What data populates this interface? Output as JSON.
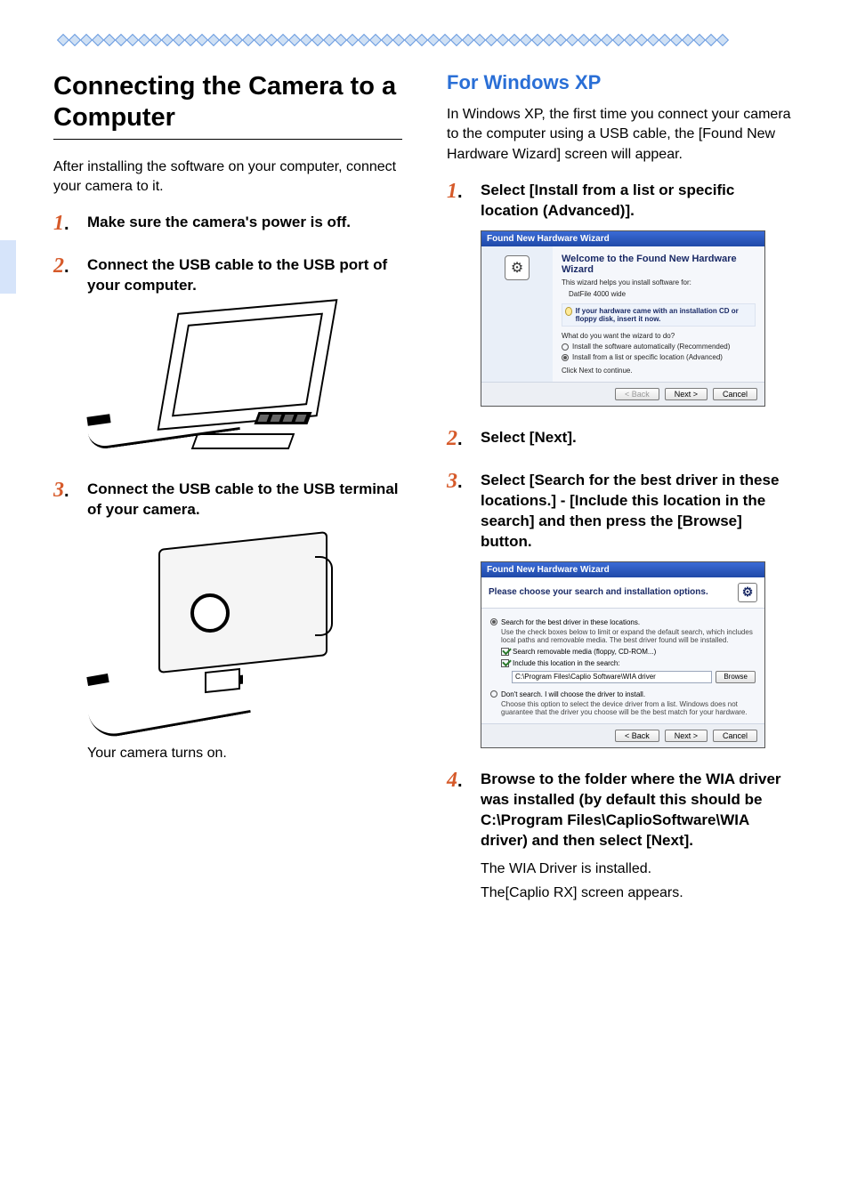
{
  "left": {
    "heading": "Connecting the Camera to a Computer",
    "intro": "After installing the software on your computer, connect your camera to it.",
    "steps": [
      {
        "num": "1",
        "text": "Make sure the camera's power is off."
      },
      {
        "num": "2",
        "text": "Connect the USB cable to the USB port of your computer."
      },
      {
        "num": "3",
        "text": "Connect the USB cable to the USB terminal of your camera."
      }
    ],
    "note_after_step3": "Your camera turns on."
  },
  "right": {
    "heading": "For Windows XP",
    "intro": "In Windows XP, the first time you connect your camera to the computer using a USB cable, the [Found New Hardware Wizard] screen will appear.",
    "steps": [
      {
        "num": "1",
        "text": "Select [Install from a list or specific location (Advanced)]."
      },
      {
        "num": "2",
        "text": "Select [Next]."
      },
      {
        "num": "3",
        "text": "Select [Search for the best driver in these locations.] - [Include this location in the search] and then press the [Browse] button."
      },
      {
        "num": "4",
        "text": "Browse to the folder where the WIA driver was installed (by default this should be C:\\Program Files\\CaplioSoftware\\WIA driver) and then select [Next]."
      }
    ],
    "sub_after_step4_1": "The WIA Driver is installed.",
    "sub_after_step4_2": "The[Caplio RX] screen appears."
  },
  "wizard1": {
    "titlebar": "Found New Hardware Wizard",
    "welcome": "Welcome to the Found New Hardware Wizard",
    "helps": "This wizard helps you install software for:",
    "device": "DatFile 4000 wide",
    "hint": "If your hardware came with an installation CD or floppy disk, insert it now.",
    "question": "What do you want the wizard to do?",
    "opt_auto": "Install the software automatically (Recommended)",
    "opt_list": "Install from a list or specific location (Advanced)",
    "click_next": "Click Next to continue.",
    "back": "< Back",
    "next": "Next >",
    "cancel": "Cancel"
  },
  "wizard2": {
    "titlebar": "Found New Hardware Wizard",
    "header": "Please choose your search and installation options.",
    "search_best": "Search for the best driver in these locations.",
    "search_desc": "Use the check boxes below to limit or expand the default search, which includes local paths and removable media. The best driver found will be installed.",
    "chk_removable": "Search removable media (floppy, CD-ROM...)",
    "chk_include": "Include this location in the search:",
    "path_value": "C:\\Program Files\\Caplio Software\\WIA driver",
    "browse": "Browse",
    "dont_search": "Don't search. I will choose the driver to install.",
    "dont_desc": "Choose this option to select the device driver from a list. Windows does not guarantee that the driver you choose will be the best match for your hardware.",
    "back": "< Back",
    "next": "Next >",
    "cancel": "Cancel"
  }
}
